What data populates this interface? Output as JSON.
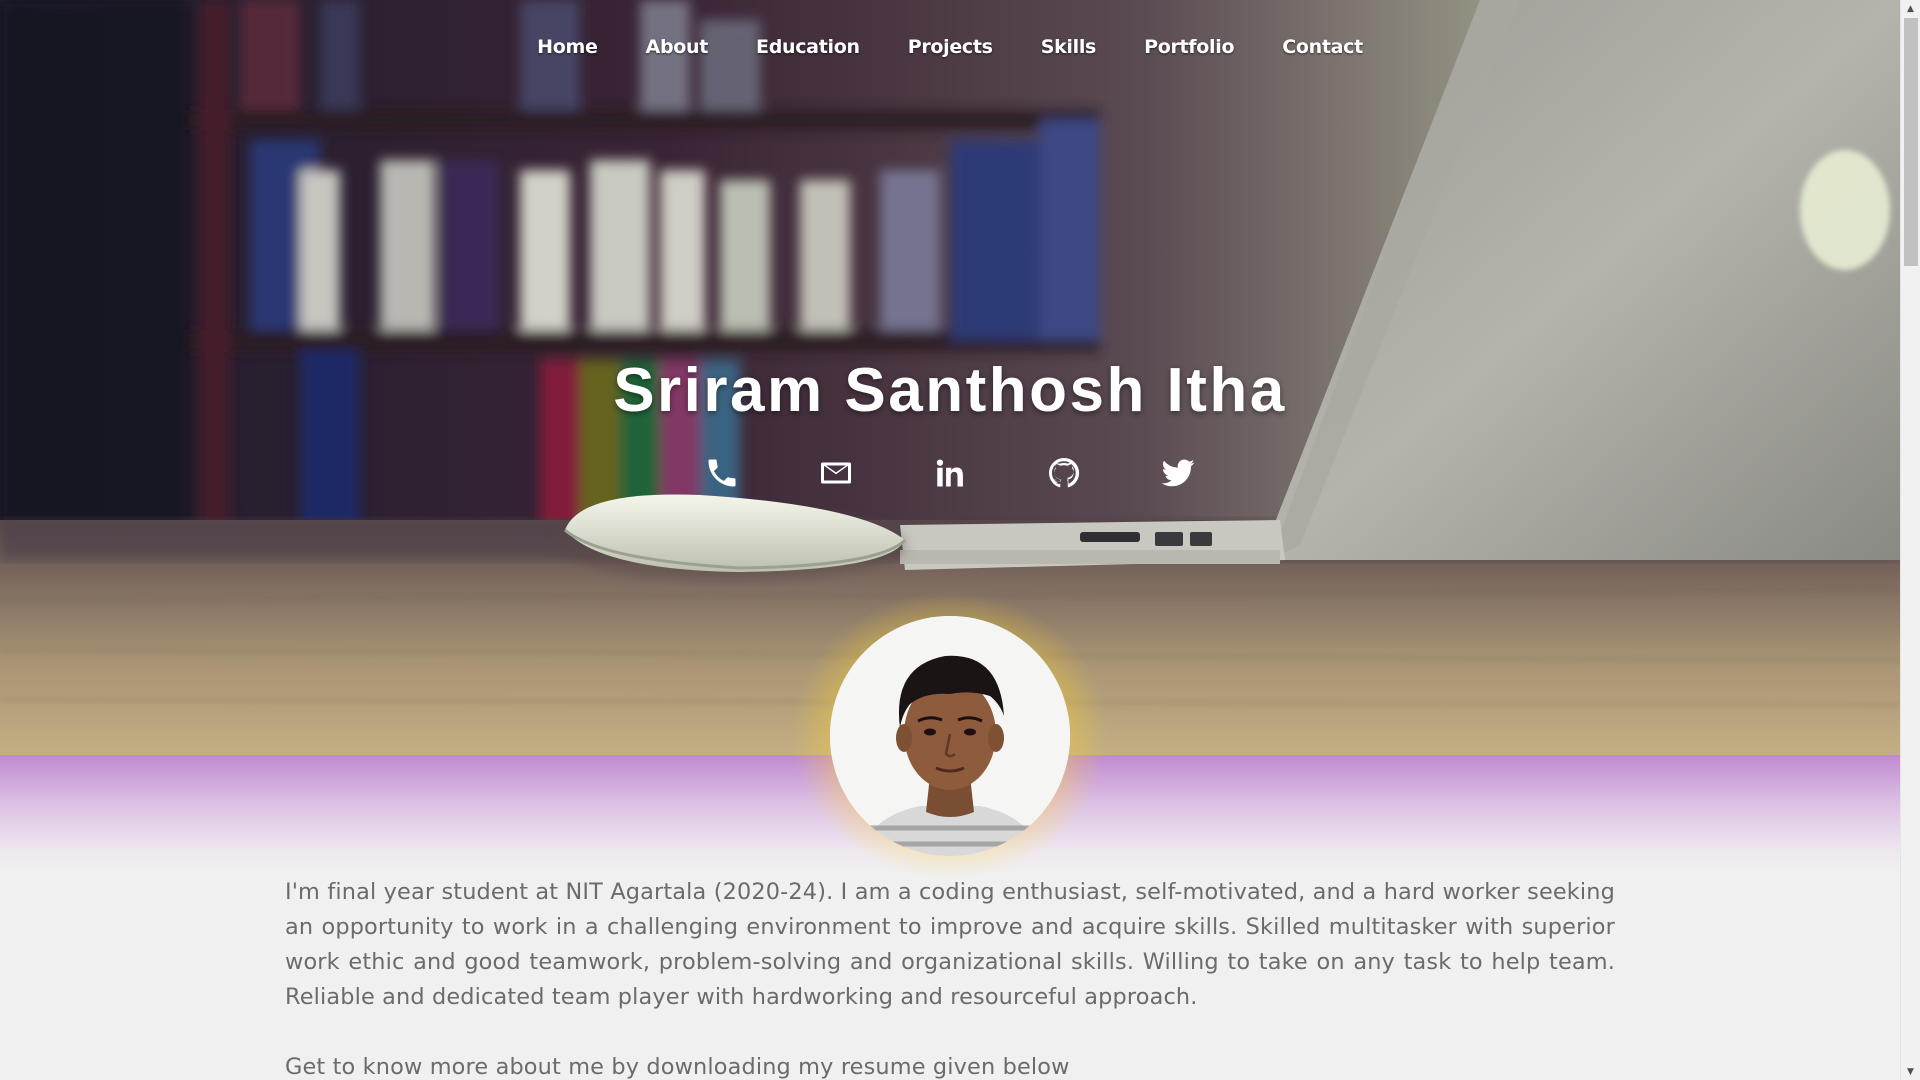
{
  "nav": {
    "items": [
      {
        "label": "Home"
      },
      {
        "label": "About"
      },
      {
        "label": "Education"
      },
      {
        "label": "Projects"
      },
      {
        "label": "Skills"
      },
      {
        "label": "Portfolio"
      },
      {
        "label": "Contact"
      }
    ]
  },
  "hero": {
    "name": "Sriram Santhosh Itha"
  },
  "social": [
    {
      "icon": "phone-icon"
    },
    {
      "icon": "email-icon"
    },
    {
      "icon": "linkedin-icon"
    },
    {
      "icon": "github-icon"
    },
    {
      "icon": "twitter-icon"
    }
  ],
  "about": {
    "paragraph": "I'm final year student at NIT Agartala (2020-24). I am a coding enthusiast, self-motivated, and a hard worker seeking an opportunity to work in a challenging environment to improve and acquire skills. Skilled multitasker with superior work ethic and good teamwork, problem-solving and organizational skills. Willing to take on any task to help team. Reliable and dedicated team player with hardworking and resourceful approach.",
    "cta": "Get to know more about me by downloading my resume given below"
  },
  "colors": {
    "nav_text": "#ffffff",
    "body_text": "#6b6b6b",
    "band_top": "#bf8ad0",
    "glow": "#ffe128",
    "background": "#f0f0f0"
  }
}
